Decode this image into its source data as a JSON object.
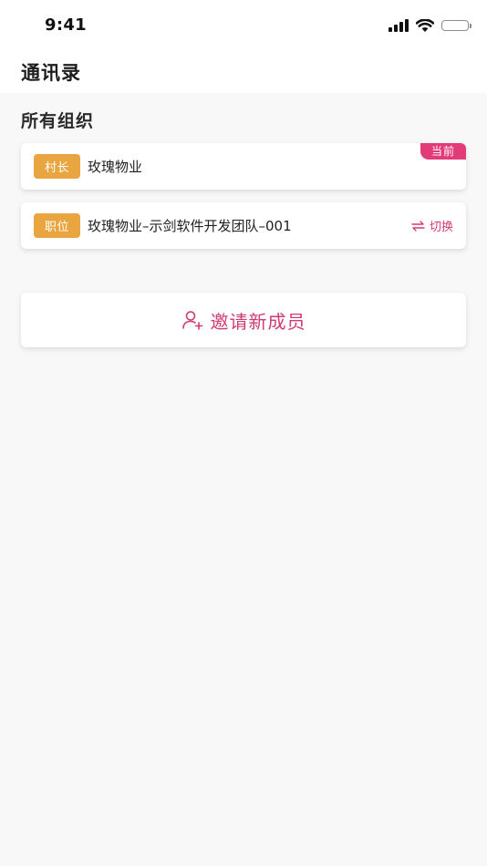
{
  "status_bar": {
    "time": "9:41"
  },
  "header": {
    "title": "通讯录"
  },
  "section": {
    "title": "所有组织"
  },
  "organizations": [
    {
      "role": "村长",
      "name": "玫瑰物业",
      "current_tag": "当前"
    },
    {
      "role": "职位",
      "name": "玫瑰物业–示剑软件开发团队–001",
      "action": "切换",
      "action_icon": "switch-arrows-icon"
    }
  ],
  "invite": {
    "label": "邀请新成员",
    "icon": "add-user-icon"
  },
  "colors": {
    "role_badge": "#e9a540",
    "accent": "#e33a78",
    "action_text": "#d83a73",
    "background": "#f8f8f8",
    "card": "#ffffff"
  }
}
